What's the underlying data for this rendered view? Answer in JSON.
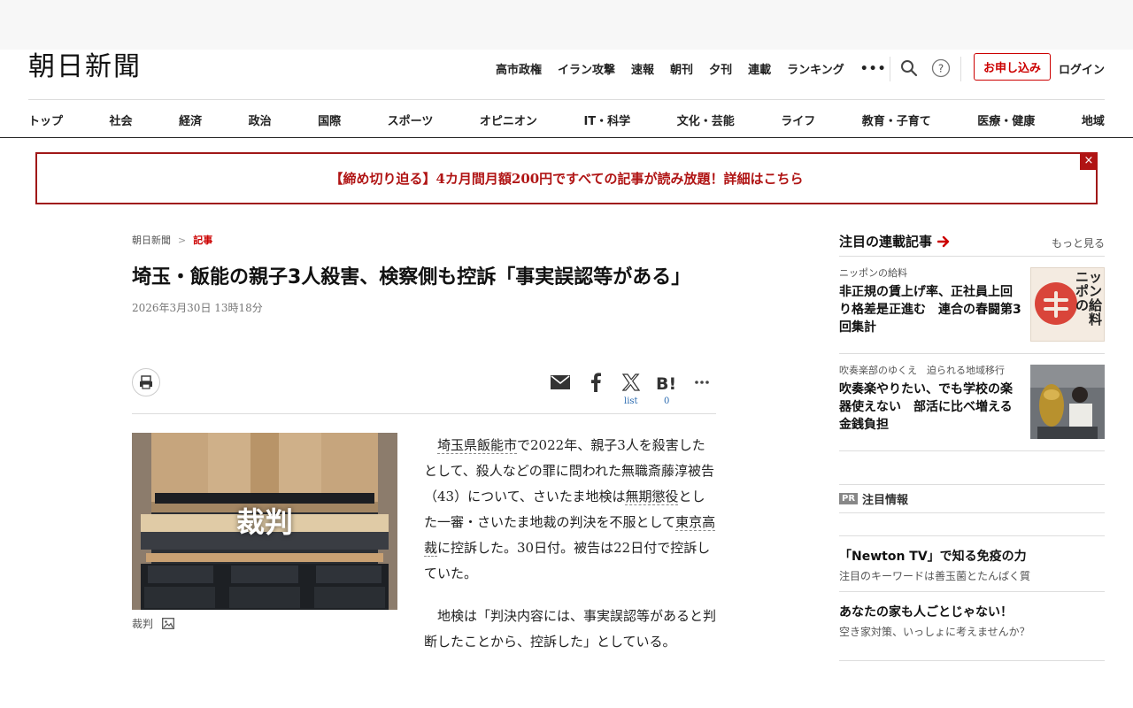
{
  "header": {
    "logo": "朝日新聞",
    "top_links": [
      "高市政権",
      "イラン攻撃",
      "速報",
      "朝刊",
      "夕刊",
      "連載",
      "ランキング"
    ],
    "more": "•••",
    "subscribe": "お申し込み",
    "login": "ログイン"
  },
  "category_nav": [
    "トップ",
    "社会",
    "経済",
    "政治",
    "国際",
    "スポーツ",
    "オピニオン",
    "IT・科学",
    "文化・芸能",
    "ライフ",
    "教育・子育て",
    "医療・健康",
    "地域"
  ],
  "banner": {
    "text": "【締め切り迫る】4カ月間月額200円ですべての記事が読み放題！詳細はこちら",
    "close": "×",
    "color": "#b01414"
  },
  "article": {
    "breadcrumb": [
      "朝日新聞",
      "記事"
    ],
    "breadcrumb_sep": ">",
    "title": "埼玉・飯能の親子3人殺害、検察側も控訴「事実誤認等がある」",
    "date": "2026年3月30日 13時18分",
    "share": {
      "x_count": "list",
      "hatena_count": "0"
    },
    "photo_label": "裁判",
    "caption": "裁判",
    "paragraphs": [
      {
        "t1": "",
        "l1": "埼玉県飯能市",
        "t2": "で2022年、親子3人を殺害したとして、殺人などの罪に問われた無職斎藤淳被告（43）について、さいたま地検は",
        "l2": "無期懲役",
        "t3": "とした一審・さいたま地裁の判決を不服として",
        "l3": "東京高裁",
        "t4": "に控訴した。30日付。被告は22日付で控訴していた。"
      },
      {
        "t1": "地検は「判決内容には、事実誤認等があると判断したことから、控訴した」としている。"
      }
    ]
  },
  "sidebar": {
    "title": "注目の連載記事",
    "more": "もっと見る",
    "series": [
      {
        "category": "ニッポンの給料",
        "title": "非正規の賃上げ率、正社員上回り格差是正進む　連合の春闘第3回集計",
        "thumb_text": "ニッポンの給料"
      },
      {
        "category": "吹奏楽部のゆくえ　迫られる地域移行",
        "title": "吹奏楽やりたい、でも学校の楽器使えない　部活に比べ増える金銭負担"
      }
    ],
    "pr": {
      "badge": "PR",
      "title": "注目情報",
      "items": [
        {
          "title": "「Newton TV」で知る免疫の力",
          "sub": "注目のキーワードは善玉菌とたんぱく質"
        },
        {
          "title": "あなたの家も人ごとじゃない！",
          "sub": "空き家対策、いっしょに考えませんか？"
        }
      ]
    }
  }
}
